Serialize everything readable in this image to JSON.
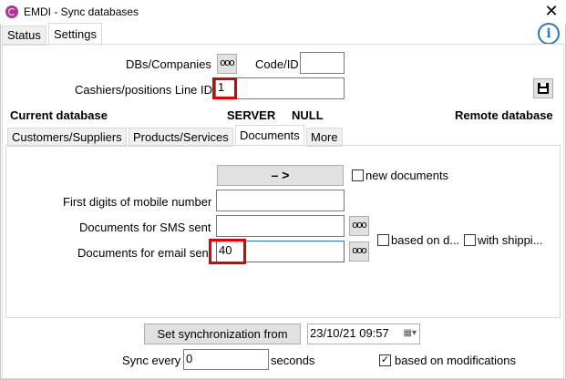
{
  "window": {
    "title": "EMDI - Sync databases",
    "close_glyph": "✕"
  },
  "tabs": [
    {
      "label": "Status"
    },
    {
      "label": "Settings"
    }
  ],
  "info_glyph": "i",
  "form": {
    "dbs_companies_label": "DBs/Companies",
    "code_id_label": "Code/ID",
    "code_id_value": "",
    "cashiers_label": "Cashiers/positions Line ID",
    "cashiers_value": "1",
    "dots_glyph": "ooo"
  },
  "db_row": {
    "current_database": "Current database",
    "server": "SERVER",
    "null": "NULL",
    "remote_database": "Remote database"
  },
  "subtabs": [
    {
      "label": "Customers/Suppliers"
    },
    {
      "label": "Products/Services"
    },
    {
      "label": "Documents"
    },
    {
      "label": "More"
    }
  ],
  "documents": {
    "arrow_button": "–  >",
    "new_documents_label": "new documents",
    "mobile_label": "First digits of mobile number",
    "mobile_value": "",
    "sms_label": "Documents for SMS sent",
    "sms_value": "",
    "email_label": "Documents for email sen",
    "email_value": "40",
    "based_on_d_label": "based on d...",
    "with_shippi_label": "with shippi..."
  },
  "bottom": {
    "set_sync_button": "Set synchronization from",
    "date_value": "23/10/21 09:57",
    "sync_every_label": "Sync every",
    "sync_every_value": "0",
    "seconds_label": "seconds",
    "based_on_modifications_label": "based on modifications",
    "based_on_modifications_checked": true
  }
}
